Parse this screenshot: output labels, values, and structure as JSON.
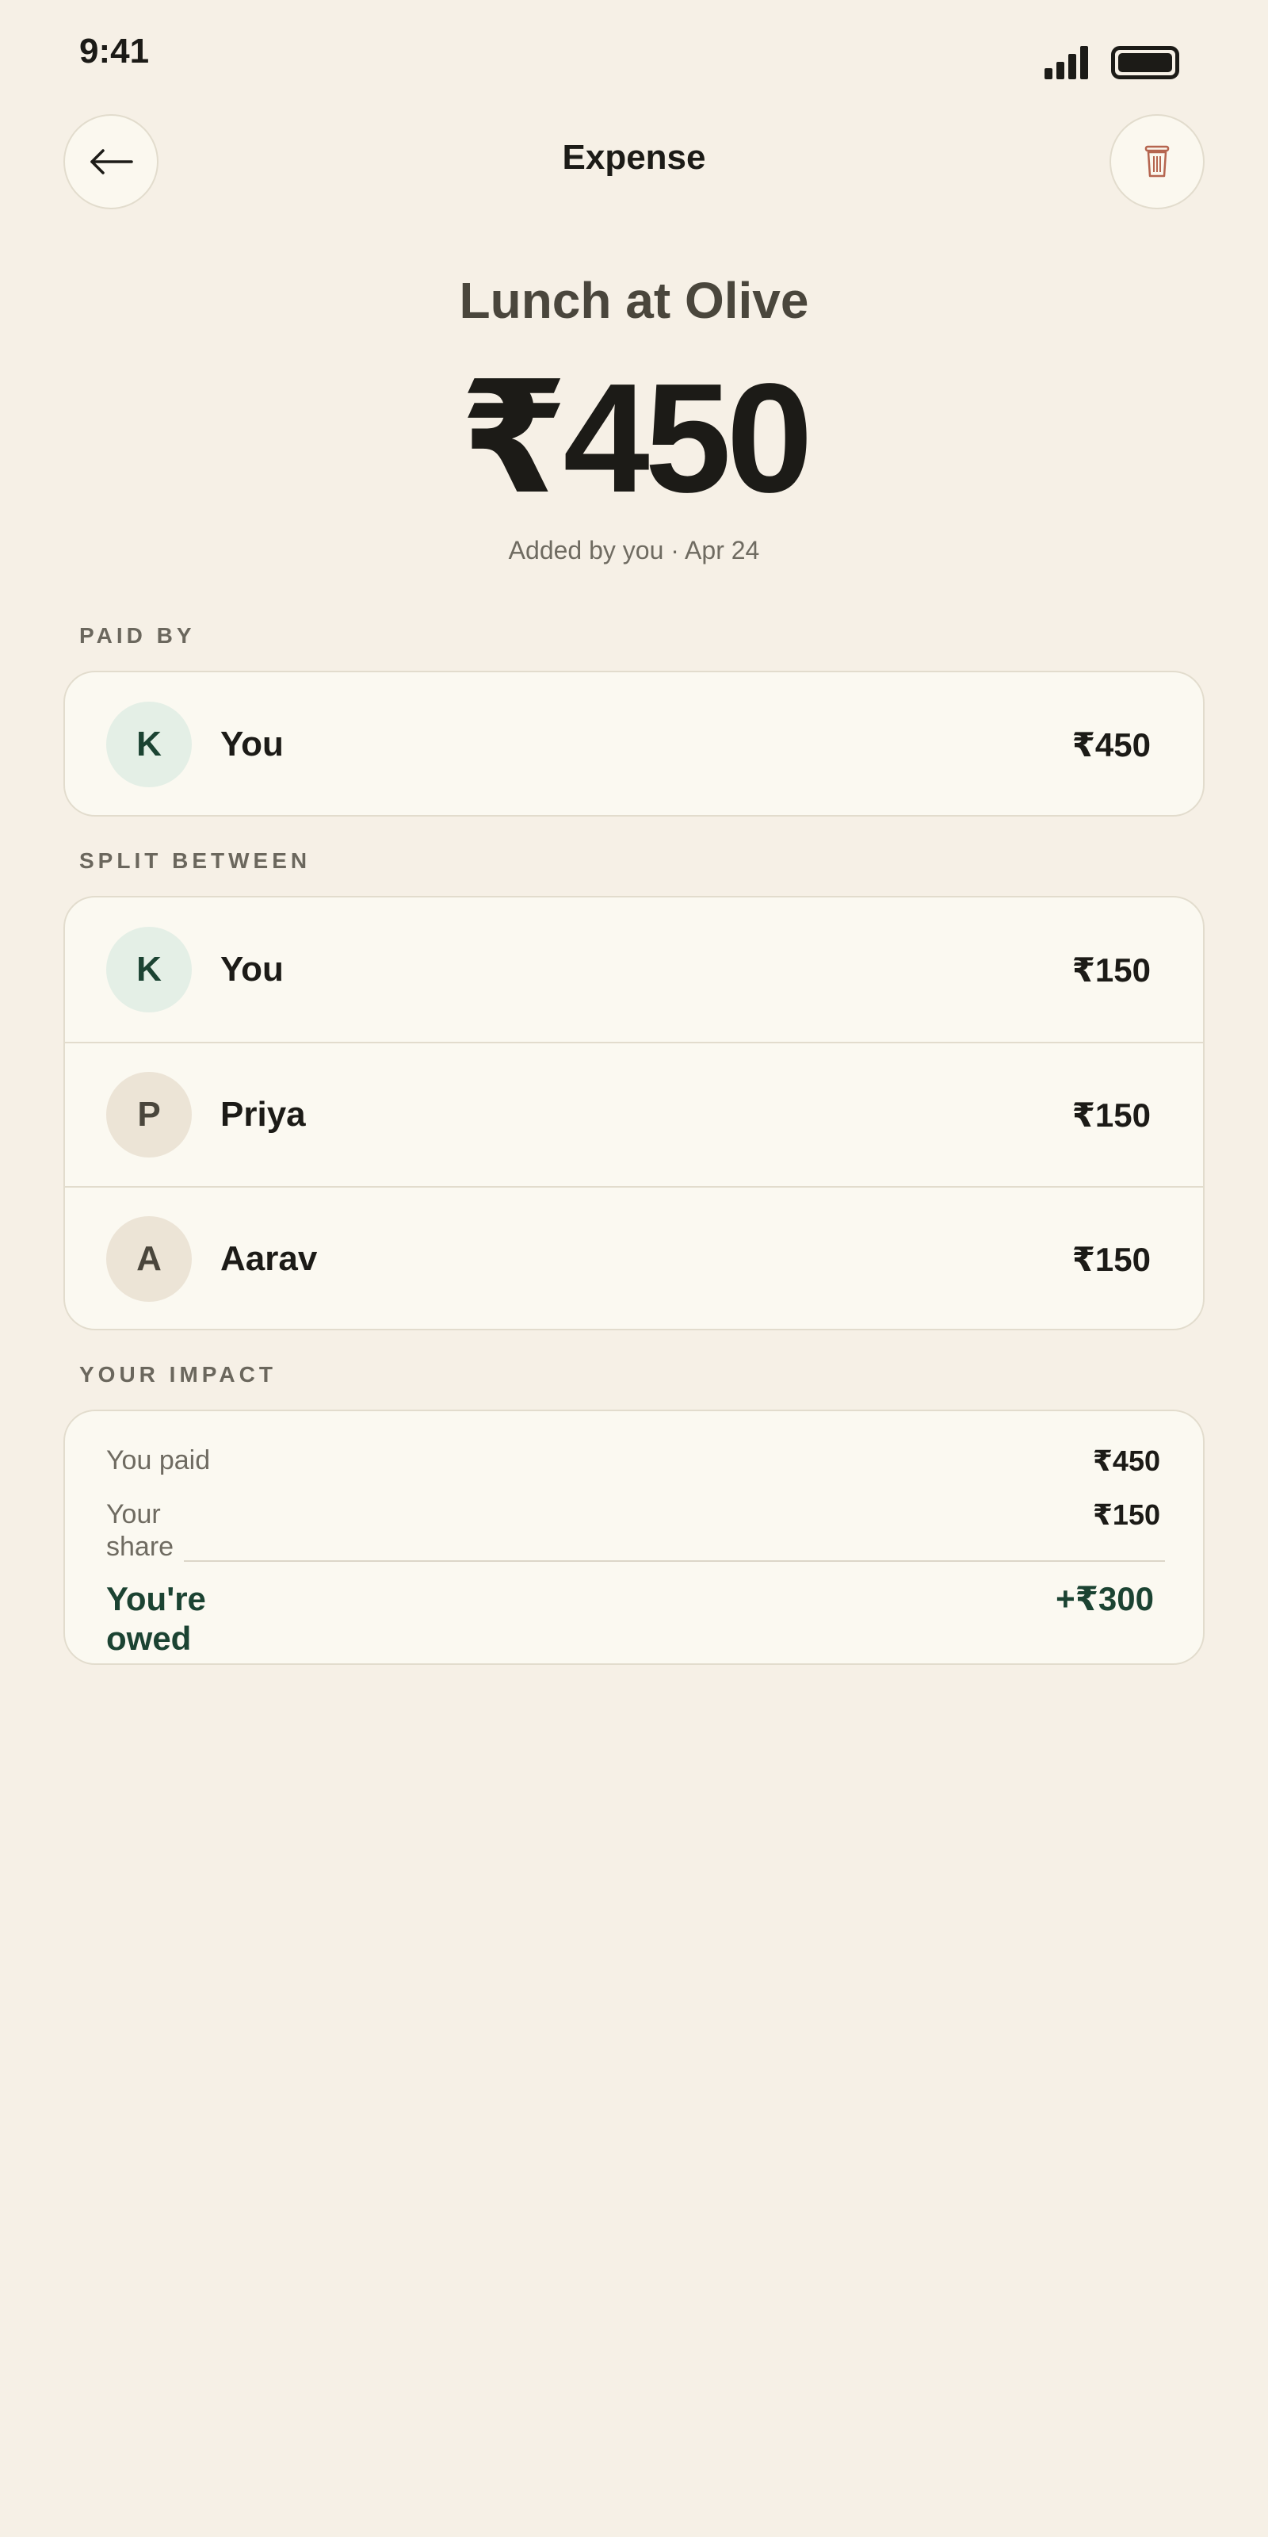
{
  "status_bar": {
    "time": "9:41"
  },
  "header": {
    "title": "Expense",
    "back_icon": "arrow-left-icon",
    "delete_icon": "trash-icon"
  },
  "expense": {
    "title": "Lunch at Olive",
    "amount": "₹450",
    "meta": "Added by you · Apr 24"
  },
  "paid_by": {
    "label": "PAID BY",
    "rows": [
      {
        "initial": "K",
        "name": "You",
        "amount": "₹450"
      }
    ]
  },
  "split_between": {
    "label": "SPLIT BETWEEN",
    "rows": [
      {
        "initial": "K",
        "name": "You",
        "amount": "₹150"
      },
      {
        "initial": "P",
        "name": "Priya",
        "amount": "₹150"
      },
      {
        "initial": "A",
        "name": "Aarav",
        "amount": "₹150"
      }
    ]
  },
  "impact": {
    "label": "YOUR IMPACT",
    "you_paid_label": "You paid",
    "you_paid_value": "₹450",
    "your_share_label": "Your share",
    "your_share_value": "₹150",
    "owed_label": "You're owed",
    "owed_value": "+₹300"
  },
  "colors": {
    "background": "#f6f0e6",
    "card": "#fbf9f1",
    "accent_green": "#1b4332",
    "delete_red": "#b5654f"
  }
}
